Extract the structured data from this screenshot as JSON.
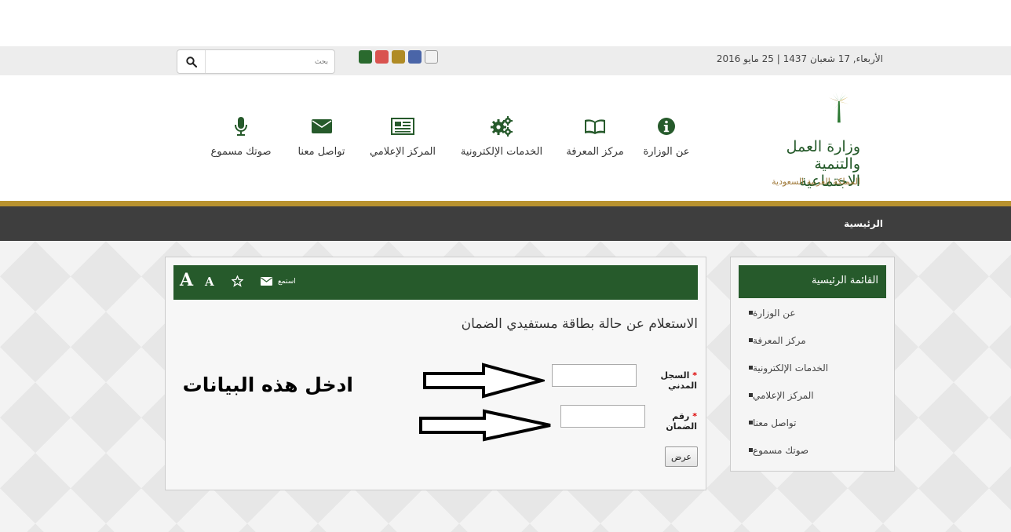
{
  "topbar": {
    "date": "الأربعاء, 17 شعبان 1437 | 25 مايو 2016",
    "search_placeholder": "بحث",
    "swatch_colors": [
      "#2a6a2e",
      "#d9534f",
      "#b08b25",
      "#4a65a8",
      "#f2f2f2"
    ]
  },
  "logo": {
    "line1": "وزارة العمل",
    "line2": "والتنمية الاجتماعية",
    "line3": "المملكة العربية السعودية"
  },
  "nav": {
    "items": [
      {
        "label": "عن الوزارة",
        "icon": "info-icon"
      },
      {
        "label": "مركز المعرفة",
        "icon": "book-icon"
      },
      {
        "label": "الخدمات الإلكترونية",
        "icon": "gears-icon"
      },
      {
        "label": "المركز الإعلامي",
        "icon": "newspaper-icon"
      },
      {
        "label": "تواصل معنا",
        "icon": "envelope-icon"
      },
      {
        "label": "صوتك مسموع",
        "icon": "microphone-icon"
      }
    ]
  },
  "breadcrumb": {
    "home": "الرئيسية"
  },
  "sidebar": {
    "title": "القائمة الرئيسية",
    "items": [
      {
        "label": "عن الوزارة"
      },
      {
        "label": "مركز المعرفة"
      },
      {
        "label": "الخدمات الإلكترونية"
      },
      {
        "label": "المركز الإعلامي"
      },
      {
        "label": "تواصل معنا"
      },
      {
        "label": "صوتك مسموع"
      }
    ]
  },
  "toolbar": {
    "listen": "استمع",
    "font_large": "A",
    "font_small": "A"
  },
  "main": {
    "title": "الاستعلام عن حالة بطاقة مستفيدي الضمان",
    "field1_label": "السجل المدني",
    "field2_label": "رقم الضمان",
    "required_mark": "*",
    "submit_label": "عرض",
    "annotation": "ادخل هذه البيانات"
  },
  "colors": {
    "brand_green": "#265a2b",
    "gold": "#b8922f",
    "dark_bar": "#3e3e3e"
  }
}
